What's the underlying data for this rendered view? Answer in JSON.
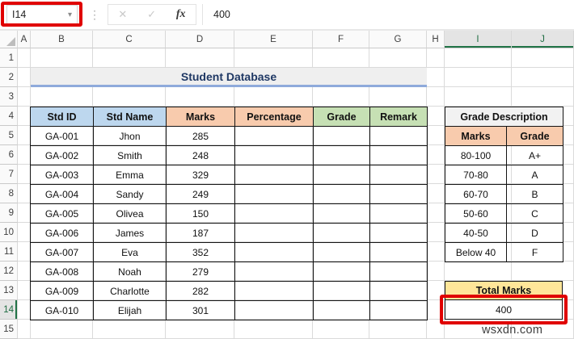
{
  "formula_bar": {
    "name_box": "I14",
    "value": "400",
    "dropdown_icon": "▾",
    "dots_icon": "⋮",
    "cancel_icon": "✕",
    "enter_icon": "✓",
    "fx_icon": "fx"
  },
  "grid": {
    "columns": [
      "A",
      "B",
      "C",
      "D",
      "E",
      "F",
      "G",
      "H",
      "I",
      "J"
    ],
    "selected_columns": [
      "I",
      "J"
    ],
    "rows": [
      "1",
      "2",
      "3",
      "4",
      "5",
      "6",
      "7",
      "8",
      "9",
      "10",
      "11",
      "12",
      "13",
      "14",
      "15"
    ],
    "selected_rows": [
      "14"
    ]
  },
  "sheet": {
    "title": "Student Database",
    "student_table": {
      "headers": [
        {
          "label": "Std ID",
          "fill": "#BDD7EE"
        },
        {
          "label": "Std Name",
          "fill": "#BDD7EE"
        },
        {
          "label": "Marks",
          "fill": "#F8CBAD"
        },
        {
          "label": "Percentage",
          "fill": "#F8CBAD"
        },
        {
          "label": "Grade",
          "fill": "#C6E0B4"
        },
        {
          "label": "Remark",
          "fill": "#C6E0B4"
        }
      ],
      "rows": [
        {
          "std_id": "GA-001",
          "std_name": "Jhon",
          "marks": "285",
          "percentage": "",
          "grade": "",
          "remark": ""
        },
        {
          "std_id": "GA-002",
          "std_name": "Smith",
          "marks": "248",
          "percentage": "",
          "grade": "",
          "remark": ""
        },
        {
          "std_id": "GA-003",
          "std_name": "Emma",
          "marks": "329",
          "percentage": "",
          "grade": "",
          "remark": ""
        },
        {
          "std_id": "GA-004",
          "std_name": "Sandy",
          "marks": "249",
          "percentage": "",
          "grade": "",
          "remark": ""
        },
        {
          "std_id": "GA-005",
          "std_name": "Olivea",
          "marks": "150",
          "percentage": "",
          "grade": "",
          "remark": ""
        },
        {
          "std_id": "GA-006",
          "std_name": "James",
          "marks": "187",
          "percentage": "",
          "grade": "",
          "remark": ""
        },
        {
          "std_id": "GA-007",
          "std_name": "Eva",
          "marks": "352",
          "percentage": "",
          "grade": "",
          "remark": ""
        },
        {
          "std_id": "GA-008",
          "std_name": "Noah",
          "marks": "279",
          "percentage": "",
          "grade": "",
          "remark": ""
        },
        {
          "std_id": "GA-009",
          "std_name": "Charlotte",
          "marks": "282",
          "percentage": "",
          "grade": "",
          "remark": ""
        },
        {
          "std_id": "GA-010",
          "std_name": "Elijah",
          "marks": "301",
          "percentage": "",
          "grade": "",
          "remark": ""
        }
      ]
    },
    "grade_table": {
      "title": "Grade Description",
      "headers": [
        "Marks",
        "Grade"
      ],
      "rows": [
        [
          "80-100",
          "A+"
        ],
        [
          "70-80",
          "A"
        ],
        [
          "60-70",
          "B"
        ],
        [
          "50-60",
          "C"
        ],
        [
          "40-50",
          "D"
        ],
        [
          "Below 40",
          "F"
        ]
      ]
    },
    "total": {
      "label": "Total Marks",
      "value": "400"
    },
    "watermark": "wsxdn.com"
  },
  "colors": {
    "header_blue": "#BDD7EE",
    "header_peach": "#F8CBAD",
    "header_green": "#C6E0B4",
    "total_yellow": "#FFE699",
    "grade_header_gray": "#F2F2F2",
    "title_text": "#1F3864",
    "title_underline": "#8EAADB",
    "annotation_red": "#E00000",
    "selection_green": "#217346"
  }
}
